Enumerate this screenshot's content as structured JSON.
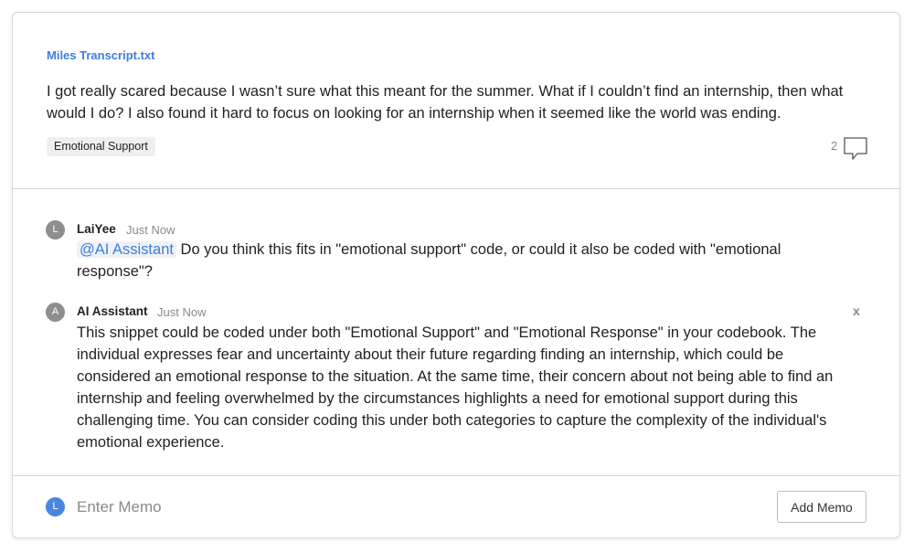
{
  "snippet": {
    "file_name": "Miles Transcript.txt",
    "text": "I got really scared because I wasn’t sure what this meant for the summer. What if I couldn’t find an internship, then what would I do? I also found it hard to focus on looking for an internship when it seemed like the world was ending.",
    "code_tag": "Emotional Support",
    "comment_count": "2",
    "comment_icon": "comment-bubble-icon"
  },
  "thread": [
    {
      "avatar_letter": "L",
      "author": "LaiYee",
      "time": "Just Now",
      "mention": "@AI Assistant",
      "text": " Do you think this fits in \"emotional support\" code, or could it also be coded with \"emotional response\"?"
    },
    {
      "avatar_letter": "A",
      "author": "AI Assistant",
      "time": "Just Now",
      "text": "This snippet could be coded under both \"Emotional Support\" and \"Emotional Response\" in your codebook. The individual expresses fear and uncertainty about their future regarding finding an internship, which could be considered an emotional response to the situation. At the same time, their concern about not being able to find an internship and feeling overwhelmed by the circumstances highlights a need for emotional support during this challenging time. You can consider coding this under both categories to capture the complexity of the individual's emotional experience.",
      "close_label": "x"
    }
  ],
  "memo": {
    "avatar_letter": "L",
    "placeholder": "Enter Memo",
    "button_label": "Add Memo"
  },
  "colors": {
    "accent": "#3d7fd8",
    "avatar_gray": "#8e8e8e",
    "avatar_blue": "#4a86e0"
  }
}
